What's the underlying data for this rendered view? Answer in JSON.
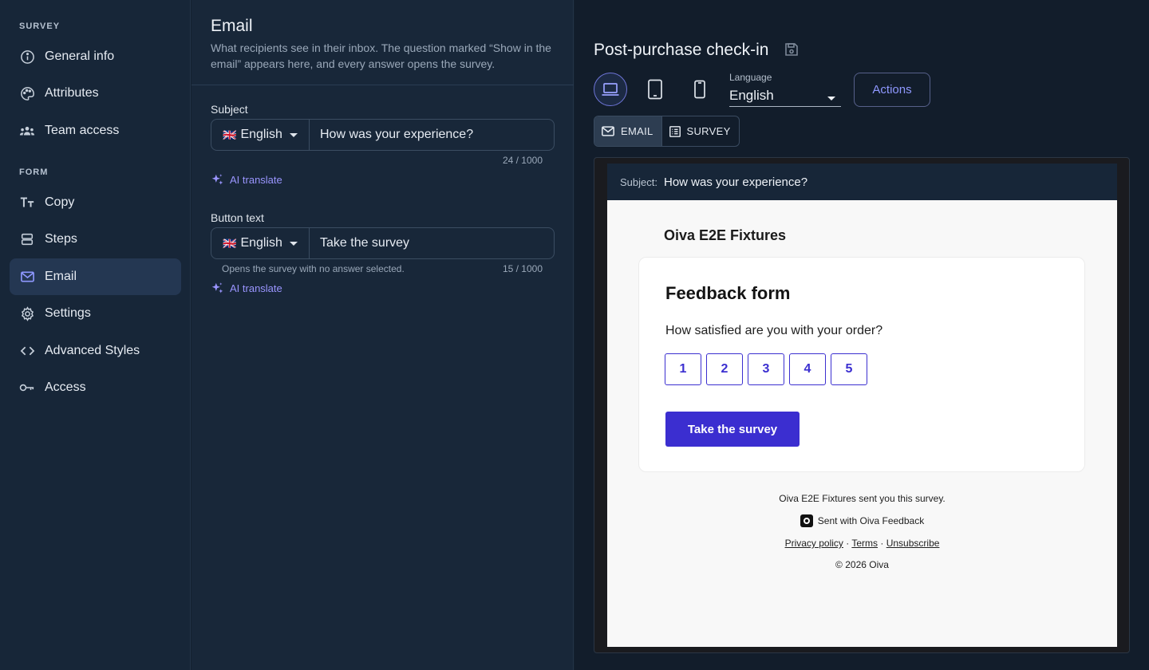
{
  "sidebar": {
    "survey_heading": "SURVEY",
    "form_heading": "FORM",
    "survey_items": [
      {
        "label": "General info",
        "icon": "info-circle-icon"
      },
      {
        "label": "Attributes",
        "icon": "palette-icon"
      },
      {
        "label": "Team access",
        "icon": "team-icon"
      }
    ],
    "form_items": [
      {
        "label": "Copy",
        "icon": "text-size-icon"
      },
      {
        "label": "Steps",
        "icon": "steps-icon"
      },
      {
        "label": "Email",
        "icon": "mail-icon",
        "active": true
      },
      {
        "label": "Settings",
        "icon": "gear-icon"
      },
      {
        "label": "Advanced Styles",
        "icon": "code-icon"
      },
      {
        "label": "Access",
        "icon": "key-icon"
      }
    ]
  },
  "editor": {
    "title": "Email",
    "description": "What recipients see in their inbox. The question marked “Show in the email” appears here, and every answer opens the survey.",
    "subject": {
      "label": "Subject",
      "language": "English",
      "flag": "🇬🇧",
      "value": "How was your experience?",
      "counter": "24 / 1000",
      "ai_label": "AI translate"
    },
    "button_text": {
      "label": "Button text",
      "language": "English",
      "flag": "🇬🇧",
      "value": "Take the survey",
      "hint": "Opens the survey with no answer selected.",
      "counter": "15 / 1000",
      "ai_label": "AI translate"
    }
  },
  "preview": {
    "title": "Post-purchase check-in",
    "language_label": "Language",
    "language_value": "English",
    "actions_label": "Actions",
    "tabs": [
      {
        "label": "EMAIL",
        "icon": "mail-icon",
        "active": true
      },
      {
        "label": "SURVEY",
        "icon": "list-icon",
        "active": false
      }
    ],
    "email": {
      "subject_key": "Subject:",
      "subject_value": "How was your experience?",
      "brand": "Oiva E2E Fixtures",
      "card_title": "Feedback form",
      "question": "How satisfied are you with your order?",
      "ratings": [
        "1",
        "2",
        "3",
        "4",
        "5"
      ],
      "button": "Take the survey",
      "footer_sent_by": "Oiva E2E Fixtures sent you this survey.",
      "footer_sent_with": "Sent with Oiva Feedback",
      "privacy": "Privacy policy",
      "sep": " · ",
      "terms": "Terms",
      "unsubscribe": "Unsubscribe",
      "copyright": "© 2026 Oiva"
    }
  },
  "colors": {
    "accent": "#8f98ff",
    "brand_button": "#3b2ed0",
    "sidebar_bg": "#172638"
  }
}
